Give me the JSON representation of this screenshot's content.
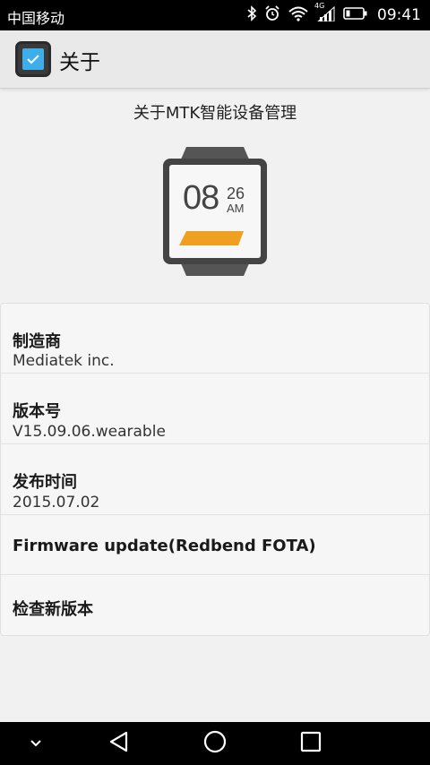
{
  "status_bar": {
    "carrier": "中国移动",
    "network_type": "4G",
    "time": "09:41",
    "icons": [
      "bluetooth-icon",
      "alarm-icon",
      "wifi-icon",
      "signal-icon",
      "battery-icon"
    ]
  },
  "action_bar": {
    "title": "关于"
  },
  "heading": "关于MTK智能设备管理",
  "watch": {
    "hour": "08",
    "minute": "26",
    "ampm": "AM",
    "accent_color": "#f0a020"
  },
  "info": {
    "manufacturer_label": "制造商",
    "manufacturer_value": "Mediatek inc.",
    "version_label": "版本号",
    "version_value": "V15.09.06.wearable",
    "release_label": "发布时间",
    "release_value": "2015.07.02",
    "firmware_label": "Firmware update(Redbend FOTA)",
    "check_label": "检查新版本"
  },
  "nav_bar": {
    "buttons": [
      "chevron-down-icon",
      "back-icon",
      "home-icon",
      "recents-icon"
    ]
  }
}
